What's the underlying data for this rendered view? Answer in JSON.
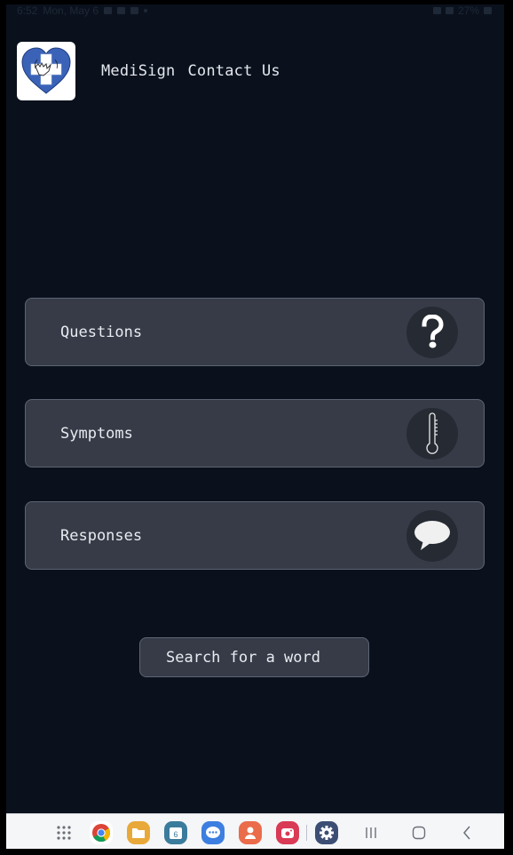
{
  "status_bar": {
    "time": "6:52",
    "date": "Mon, May 6",
    "battery": "27%"
  },
  "header": {
    "app_name": "MediSign",
    "contact_label": "Contact Us",
    "logo_icon": "heart-cross-hand-logo"
  },
  "categories": [
    {
      "label": "Questions",
      "icon": "question-mark-icon"
    },
    {
      "label": "Symptoms",
      "icon": "thermometer-icon"
    },
    {
      "label": "Responses",
      "icon": "speech-bubble-icon"
    }
  ],
  "search": {
    "label": "Search for a word"
  },
  "nav_bar": {
    "apps": [
      {
        "name": "app-drawer",
        "icon": "grid-icon"
      },
      {
        "name": "chrome",
        "icon": "chrome-icon"
      },
      {
        "name": "my-files",
        "icon": "folder-icon"
      },
      {
        "name": "calendar",
        "icon": "calendar-icon",
        "badge": "6"
      },
      {
        "name": "messages",
        "icon": "chat-icon"
      },
      {
        "name": "contacts",
        "icon": "contact-icon"
      },
      {
        "name": "screen-recorder",
        "icon": "camera-icon"
      },
      {
        "name": "settings",
        "icon": "gear-icon"
      }
    ],
    "system": [
      "recents",
      "home",
      "back"
    ]
  },
  "colors": {
    "background": "#0a111d",
    "card": "#363b47",
    "card_border": "#5d6474",
    "icon_circle": "#252a33",
    "logo_blue": "#3a63b8",
    "text": "#e8ebf0"
  }
}
